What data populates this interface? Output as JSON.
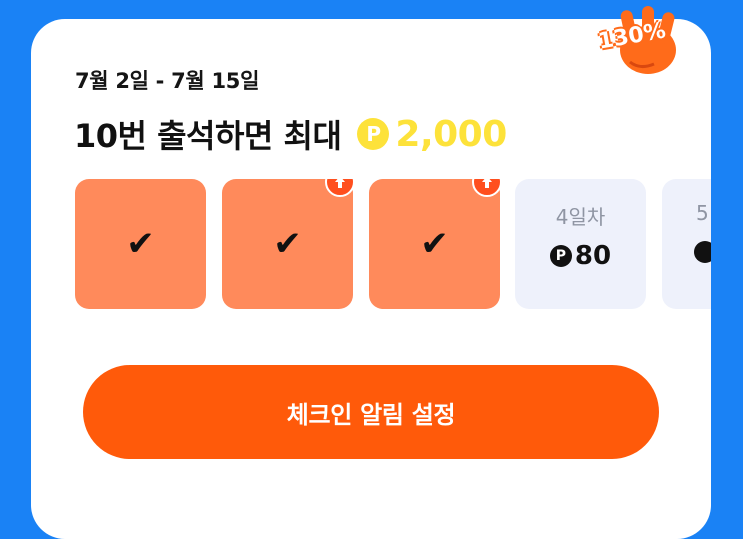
{
  "period": "7월 2일 - 7월 15일",
  "headline": {
    "text": "10번 출석하면 최대",
    "coin_symbol": "P",
    "amount": "2,000"
  },
  "days": [
    {
      "status": "checked",
      "icon": "check-icon",
      "boost": false
    },
    {
      "status": "checked",
      "icon": "check-icon",
      "boost": true
    },
    {
      "status": "checked",
      "icon": "check-icon",
      "boost": true
    },
    {
      "status": "upcoming",
      "label": "4일차",
      "reward": "80",
      "coin_symbol": "P"
    },
    {
      "status": "upcoming",
      "label": "5"
    }
  ],
  "cta": {
    "label": "체크인 알림 설정"
  },
  "badge": {
    "text": "130%",
    "icon": "hand-icon"
  },
  "colors": {
    "background": "#1a82f5",
    "card": "#ffffff",
    "checked_day": "#ff8a5b",
    "upcoming_day": "#eef1fb",
    "coin": "#fde23a",
    "cta": "#ff5a0a",
    "boost": "#ff4f1e"
  }
}
